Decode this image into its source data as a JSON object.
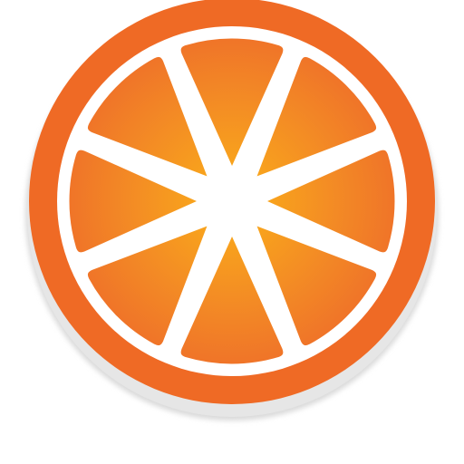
{
  "icon": {
    "name": "orange-slice-icon",
    "segment_count": 8
  },
  "colors": {
    "background": "#ffffff",
    "rind": "#ef6a25",
    "rind_inner_border": "#ffffff",
    "segment_outer": "#ee6a2a",
    "segment_inner": "#fbb018",
    "shadow": "#d9d9d9",
    "center": "#ffffff"
  }
}
